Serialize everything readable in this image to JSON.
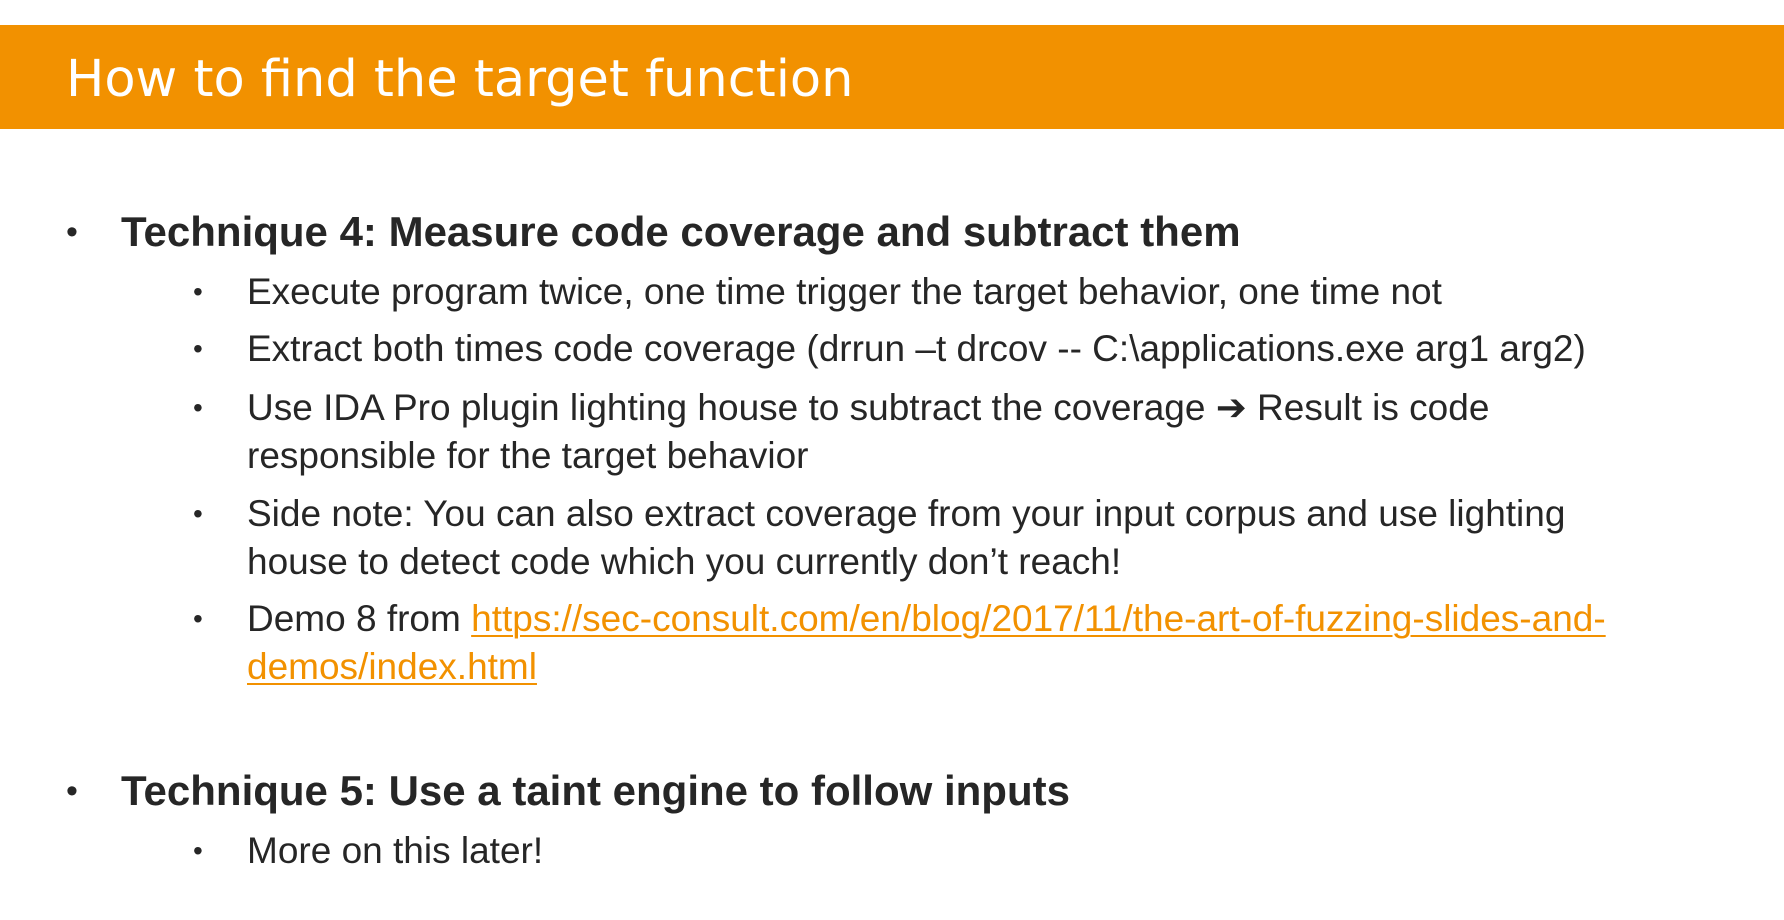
{
  "title": "How to find the target function",
  "technique4": {
    "heading": "Technique 4: Measure code coverage and subtract them",
    "items": [
      {
        "text": "Execute program twice, one time trigger the target behavior, one time not"
      },
      {
        "text": "Extract both times code coverage (drrun –t drcov -- C:\\applications.exe arg1 arg2)"
      },
      {
        "line1": "Use IDA Pro plugin lighting house to subtract the coverage ➔ Result is code",
        "line2": "responsible for the target behavior"
      },
      {
        "line1": "Side note: You can also extract coverage from your input corpus and use lighting",
        "line2": "house to detect code which you currently don’t reach!"
      },
      {
        "prefix": "Demo 8 from ",
        "link_line1": "https://sec-consult.com/en/blog/2017/11/the-art-of-fuzzing-slides-and-",
        "link_line2": "demos/index.html"
      }
    ]
  },
  "technique5": {
    "heading": "Technique 5: Use a taint engine to follow inputs",
    "items": [
      {
        "text": "More on this later!"
      }
    ]
  },
  "bullet_char": "•",
  "colors": {
    "title_bar": "#f29100",
    "title_text": "#ffffff",
    "body_text": "#262626",
    "link": "#f29100"
  }
}
